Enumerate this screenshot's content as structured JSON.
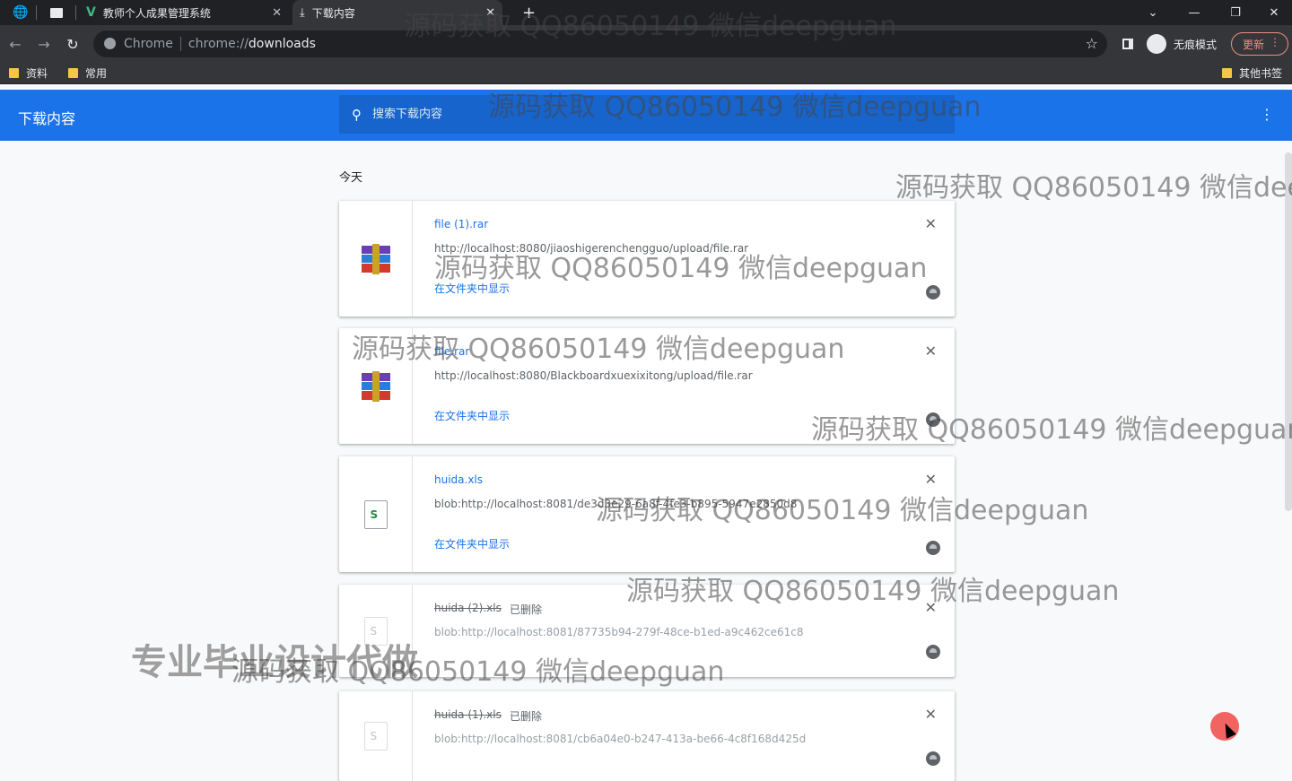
{
  "browser": {
    "tabs": [
      {
        "label": "",
        "icon": "globe-icon"
      },
      {
        "label": "",
        "icon": "window-icon"
      },
      {
        "label": "教师个人成果管理系统",
        "icon": "vue-icon"
      },
      {
        "label": "下载内容",
        "icon": "download-icon",
        "active": true
      }
    ],
    "new_tab_label": "+",
    "omnibox": {
      "site_chip": "Chrome",
      "scheme": "chrome://",
      "host": "downloads"
    },
    "profile_label": "无痕模式",
    "update_label": "更新",
    "bookmarks": [
      {
        "label": "资料"
      },
      {
        "label": "常用"
      }
    ],
    "other_bookmarks_label": "其他书签"
  },
  "page": {
    "title": "下载内容",
    "search_placeholder": "搜索下载内容",
    "date_label": "今天"
  },
  "downloads": [
    {
      "file_name": "file (1).rar",
      "url": "http://localhost:8080/jiaoshigerenchengguo/upload/file.rar",
      "action": "在文件夹中显示",
      "status": "",
      "icon": "rar-archive-icon"
    },
    {
      "file_name": "file.rar",
      "url": "http://localhost:8080/Blackboardxuexixitong/upload/file.rar",
      "action": "在文件夹中显示",
      "status": "",
      "icon": "rar-archive-icon"
    },
    {
      "file_name": "huida.xls",
      "url": "blob:http://localhost:8081/de3d3e29-6a8f-4fe3-b895-5947e2850d8",
      "action": "在文件夹中显示",
      "status": "",
      "icon": "spreadsheet-icon"
    },
    {
      "file_name": "huida (2).xls",
      "url": "blob:http://localhost:8081/87735b94-279f-48ce-b1ed-a9c462ce61c8",
      "action": "",
      "status": "已删除",
      "icon": "document-icon"
    },
    {
      "file_name": "huida (1).xls",
      "url": "blob:http://localhost:8081/cb6a04e0-b247-413a-be66-4c8f168d425d",
      "action": "",
      "status": "已删除",
      "icon": "document-icon"
    }
  ],
  "watermarks": {
    "text": "源码获取 QQ86050149 微信deepguan",
    "text_cut": "源码获取 QQ86050149 微信dee",
    "banner": "专业毕业设计代做"
  },
  "colors": {
    "header": "#1a73e8",
    "link": "#1a73e8",
    "chrome_dark": "#202124"
  }
}
